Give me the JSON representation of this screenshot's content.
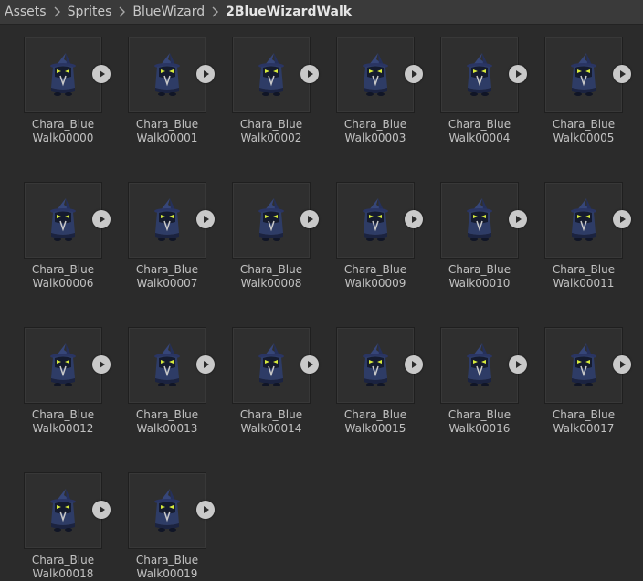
{
  "breadcrumb": {
    "items": [
      "Assets",
      "Sprites",
      "BlueWizard"
    ],
    "current": "2BlueWizardWalk"
  },
  "assets": [
    {
      "line1": "Chara_Blue",
      "line2": "Walk00000"
    },
    {
      "line1": "Chara_Blue",
      "line2": "Walk00001"
    },
    {
      "line1": "Chara_Blue",
      "line2": "Walk00002"
    },
    {
      "line1": "Chara_Blue",
      "line2": "Walk00003"
    },
    {
      "line1": "Chara_Blue",
      "line2": "Walk00004"
    },
    {
      "line1": "Chara_Blue",
      "line2": "Walk00005"
    },
    {
      "line1": "Chara_Blue",
      "line2": "Walk00006"
    },
    {
      "line1": "Chara_Blue",
      "line2": "Walk00007"
    },
    {
      "line1": "Chara_Blue",
      "line2": "Walk00008"
    },
    {
      "line1": "Chara_Blue",
      "line2": "Walk00009"
    },
    {
      "line1": "Chara_Blue",
      "line2": "Walk00010"
    },
    {
      "line1": "Chara_Blue",
      "line2": "Walk00011"
    },
    {
      "line1": "Chara_Blue",
      "line2": "Walk00012"
    },
    {
      "line1": "Chara_Blue",
      "line2": "Walk00013"
    },
    {
      "line1": "Chara_Blue",
      "line2": "Walk00014"
    },
    {
      "line1": "Chara_Blue",
      "line2": "Walk00015"
    },
    {
      "line1": "Chara_Blue",
      "line2": "Walk00016"
    },
    {
      "line1": "Chara_Blue",
      "line2": "Walk00017"
    },
    {
      "line1": "Chara_Blue",
      "line2": "Walk00018"
    },
    {
      "line1": "Chara_Blue",
      "line2": "Walk00019"
    }
  ],
  "icons": {
    "thumbnail": "blue-wizard-sprite-icon",
    "play": "play-icon",
    "separator": "chevron-right-icon"
  },
  "colors": {
    "background": "#2b2b2b",
    "breadcrumb_bar": "#3a3a3a",
    "wizard_robe": "#2e3c66",
    "wizard_eyes": "#d8ec3c",
    "play_button": "#c9c9c9"
  }
}
